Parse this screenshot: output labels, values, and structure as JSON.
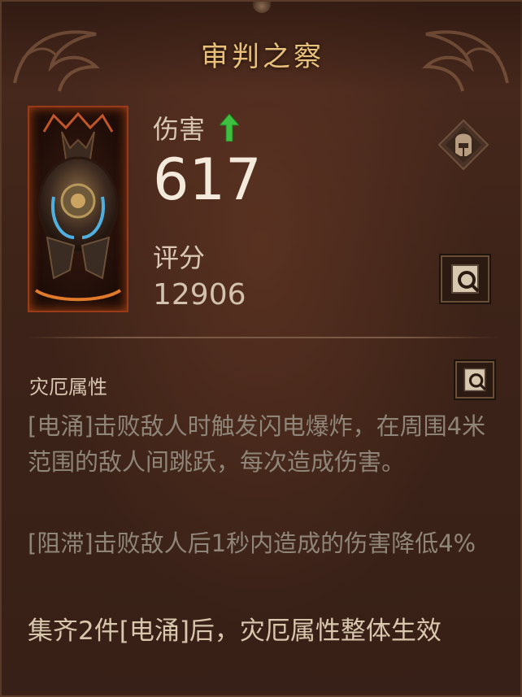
{
  "item": {
    "name": "审判之察",
    "damage_label": "伤害",
    "damage_value": "617",
    "score_label": "评分",
    "score_value": "12906"
  },
  "affix": {
    "section_title": "灾厄属性",
    "desc_line_1": "[电涌]击败敌人时触发闪电爆炸，在周围4米范围的敌人间跳跃，每次造成伤害。",
    "desc_line_2": "[阻滞]击败敌人后1秒内造成的伤害降低4%",
    "set_bonus": "集齐2件[电涌]后，灾厄属性整体生效"
  },
  "icons": {
    "upgrade": "green-up-arrow-icon",
    "slot": "helmet-slot-icon",
    "inspect": "magnifier-scroll-icon"
  },
  "colors": {
    "title": "#e8c07a",
    "upgrade": "#3fbf3f",
    "card_border": "#9a3a18"
  }
}
